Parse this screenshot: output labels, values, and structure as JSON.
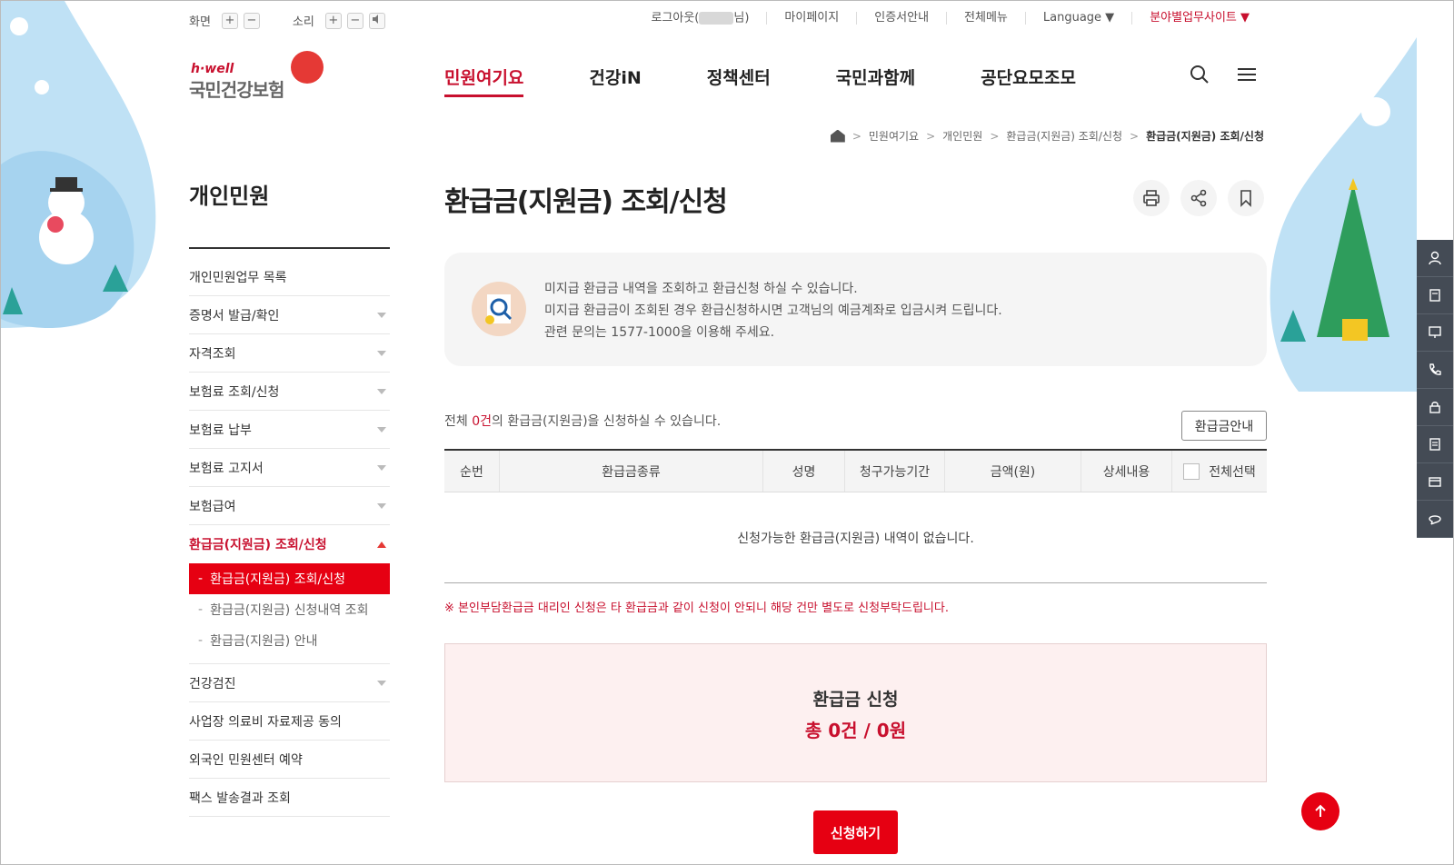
{
  "util": {
    "screen_label": "화면",
    "sound_label": "소리",
    "plus": "+",
    "minus": "−",
    "logout_prefix": "로그아웃(",
    "logout_suffix": "님)",
    "links": [
      "마이페이지",
      "인증서안내",
      "전체메뉴"
    ],
    "language_label": "Language ▼",
    "field_site_label": "분야별업무사이트 ▼"
  },
  "logo": {
    "brand": "h·well",
    "name": "국민건강보험"
  },
  "gnb": {
    "menus": [
      "민원여기요",
      "건강iN",
      "정책센터",
      "국민과함께",
      "공단요모조모"
    ]
  },
  "breadcrumb": [
    "민원여기요",
    "개인민원",
    "환급금(지원금) 조회/신청",
    "환급금(지원금) 조회/신청"
  ],
  "sidebar": {
    "title": "개인민원",
    "items": [
      {
        "label": "개인민원업무 목록"
      },
      {
        "label": "증명서 발급/확인"
      },
      {
        "label": "자격조회"
      },
      {
        "label": "보험료 조회/신청"
      },
      {
        "label": "보험료 납부"
      },
      {
        "label": "보험료 고지서"
      },
      {
        "label": "보험급여"
      },
      {
        "label": "환급금(지원금) 조회/신청"
      },
      {
        "label": "건강검진"
      },
      {
        "label": "사업장 의료비 자료제공 동의"
      },
      {
        "label": "외국인 민원센터 예약"
      },
      {
        "label": "팩스 발송결과 조회"
      }
    ],
    "sub_items": [
      "환급금(지원금) 조회/신청",
      "환급금(지원금) 신청내역 조회",
      "환급금(지원금) 안내"
    ]
  },
  "main": {
    "title": "환급금(지원금) 조회/신청",
    "info_lines": [
      "미지급 환급금 내역을 조회하고 환급신청 하실 수 있습니다.",
      "미지급 환급금이 조회된 경우 환급신청하시면 고객님의 예금계좌로 입금시켜 드립니다.",
      "관련 문의는 1577-1000을 이용해 주세요."
    ],
    "count_prefix": "전체 ",
    "count_num": "0건",
    "count_suffix": "의 환급금(지원금)을 신청하실 수 있습니다.",
    "guide_button": "환급금안내",
    "table_headers": [
      "순번",
      "환급금종류",
      "성명",
      "청구가능기간",
      "금액(원)",
      "상세내용",
      "전체선택"
    ],
    "empty_text": "신청가능한 환급금(지원금) 내역이 없습니다.",
    "notice": "※ 본인부담환급금 대리인 신청은 타 환급금과 같이 신청이 안되니 해당 건만 별도로 신청부탁드립니다.",
    "summary_title": "환급금 신청",
    "summary_value": "총 0건 / 0원",
    "apply_button": "신청하기"
  },
  "colors": {
    "accent": "#e60012",
    "brand_red": "#c8102e"
  }
}
